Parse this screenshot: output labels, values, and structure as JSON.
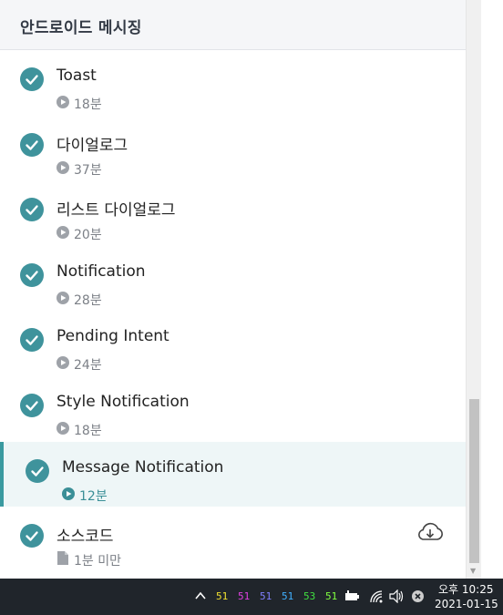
{
  "section": {
    "title": "안드로이드 메시징"
  },
  "lectures": [
    {
      "title": "Toast",
      "duration": "18분",
      "type": "video",
      "completed": true,
      "active": false
    },
    {
      "title": "다이얼로그",
      "duration": "37분",
      "type": "video",
      "completed": true,
      "active": false
    },
    {
      "title": "리스트 다이얼로그",
      "duration": "20분",
      "type": "video",
      "completed": true,
      "active": false
    },
    {
      "title": "Notification",
      "duration": "28분",
      "type": "video",
      "completed": true,
      "active": false
    },
    {
      "title": "Pending Intent",
      "duration": "24분",
      "type": "video",
      "completed": true,
      "active": false
    },
    {
      "title": "Style Notification",
      "duration": "18분",
      "type": "video",
      "completed": true,
      "active": false
    },
    {
      "title": "Message Notification",
      "duration": "12분",
      "type": "video",
      "completed": true,
      "active": true
    },
    {
      "title": "소스코드",
      "duration": "1분 미만",
      "type": "file",
      "completed": true,
      "active": false,
      "download_icon": "cloud-download-icon"
    }
  ],
  "colors": {
    "accent": "#3f939c",
    "active_bg": "#eef6f7",
    "active_bar": "#3a9aa0",
    "taskbar": "#20252b"
  },
  "taskbar": {
    "tray_numbers": [
      {
        "value": "51",
        "color": "#f0e030"
      },
      {
        "value": "51",
        "color": "#e040e0"
      },
      {
        "value": "51",
        "color": "#8080ff"
      },
      {
        "value": "51",
        "color": "#40b0ff"
      },
      {
        "value": "53",
        "color": "#40e040"
      },
      {
        "value": "51",
        "color": "#80ff40"
      }
    ],
    "icons": [
      "chevron-up-icon",
      "battery-icon",
      "wifi-icon",
      "volume-icon",
      "close-circle-icon"
    ],
    "time": "오후 10:25",
    "date": "2021-01-15"
  }
}
